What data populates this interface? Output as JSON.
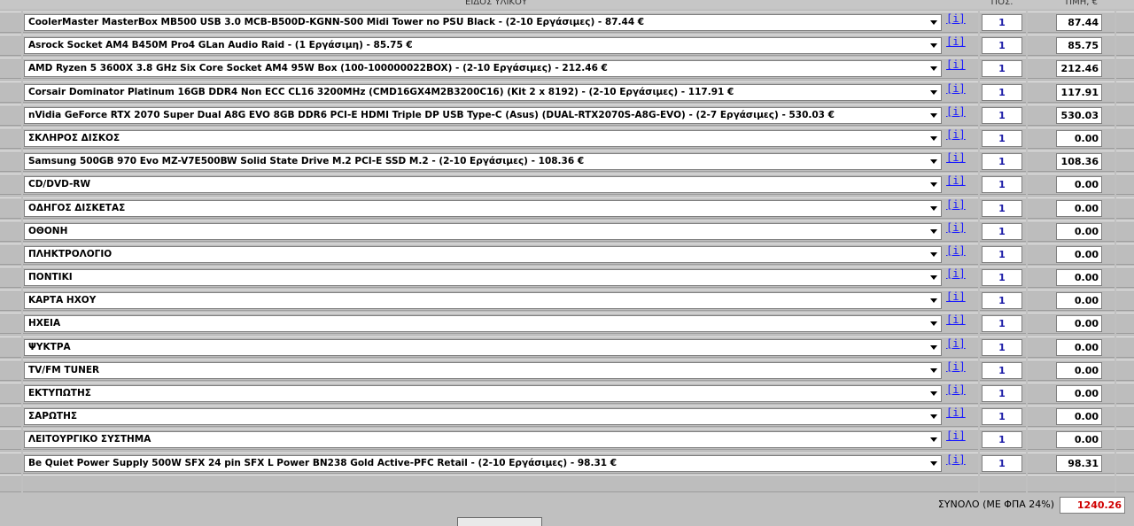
{
  "header": {
    "item_col": "ΕΙΔΟΣ ΥΛΙΚΟΥ",
    "qty_col": "ΠΟΣ.",
    "price_col": "ΤΙΜΗ, €"
  },
  "info_label": "[i]",
  "rows": [
    {
      "item": "CoolerMaster MasterBox MB500 USB 3.0 MCB-B500D-KGNN-S00 Midi Tower no PSU Black - (2-10 Εργάσιμες) - 87.44 €",
      "qty": "1",
      "price": "87.44"
    },
    {
      "item": "Asrock Socket AM4 B450M Pro4 GLan Audio Raid - (1 Εργάσιμη) - 85.75 €",
      "qty": "1",
      "price": "85.75"
    },
    {
      "item": "AMD Ryzen 5 3600X 3.8 GHz Six Core Socket AM4 95W Box (100-100000022BOX) - (2-10 Εργάσιμες) - 212.46 €",
      "qty": "1",
      "price": "212.46"
    },
    {
      "item": "Corsair Dominator Platinum 16GB DDR4 Non ECC CL16 3200MHz (CMD16GX4M2B3200C16) (Kit 2 x 8192) - (2-10 Εργάσιμες) - 117.91 €",
      "qty": "1",
      "price": "117.91"
    },
    {
      "item": "nVidia GeForce RTX 2070 Super Dual A8G EVO 8GB DDR6 PCI-E HDMI Triple DP USB Type-C (Asus) (DUAL-RTX2070S-A8G-EVO) - (2-7 Εργάσιμες) - 530.03 €",
      "qty": "1",
      "price": "530.03"
    },
    {
      "item": "ΣΚΛΗΡΟΣ ΔΙΣΚΟΣ",
      "qty": "1",
      "price": "0.00"
    },
    {
      "item": "Samsung 500GB 970 Evo MZ-V7E500BW Solid State Drive M.2 PCI-E SSD M.2 - (2-10 Εργάσιμες) - 108.36 €",
      "qty": "1",
      "price": "108.36"
    },
    {
      "item": "CD/DVD-RW",
      "qty": "1",
      "price": "0.00"
    },
    {
      "item": "ΟΔΗΓΟΣ ΔΙΣΚΕΤΑΣ",
      "qty": "1",
      "price": "0.00"
    },
    {
      "item": "ΟΘΟΝΗ",
      "qty": "1",
      "price": "0.00"
    },
    {
      "item": "ΠΛΗΚΤΡΟΛΟΓΙΟ",
      "qty": "1",
      "price": "0.00"
    },
    {
      "item": "ΠΟΝΤΙΚΙ",
      "qty": "1",
      "price": "0.00"
    },
    {
      "item": "ΚΑΡΤΑ ΗΧΟΥ",
      "qty": "1",
      "price": "0.00"
    },
    {
      "item": "ΗΧΕΙΑ",
      "qty": "1",
      "price": "0.00"
    },
    {
      "item": "ΨΥΚΤΡΑ",
      "qty": "1",
      "price": "0.00"
    },
    {
      "item": "TV/FM TUNER",
      "qty": "1",
      "price": "0.00"
    },
    {
      "item": "ΕΚΤΥΠΩΤΗΣ",
      "qty": "1",
      "price": "0.00"
    },
    {
      "item": "ΣΑΡΩΤΗΣ",
      "qty": "1",
      "price": "0.00"
    },
    {
      "item": "ΛΕΙΤΟΥΡΓΙΚΟ ΣΥΣΤΗΜΑ",
      "qty": "1",
      "price": "0.00"
    },
    {
      "item": "Be Quiet Power Supply 500W SFX 24 pin SFX L Power BN238 Gold Active-PFC Retail - (2-10 Εργάσιμες) - 98.31 €",
      "qty": "1",
      "price": "98.31"
    }
  ],
  "footer": {
    "total_label": "ΣΥΝΟΛΟ (ΜΕ ΦΠΑ 24%)",
    "total_value": "1240.26"
  },
  "colors": {
    "total": "#d00000",
    "qty": "#1a1aa6",
    "info_link": "#1a1aff"
  }
}
